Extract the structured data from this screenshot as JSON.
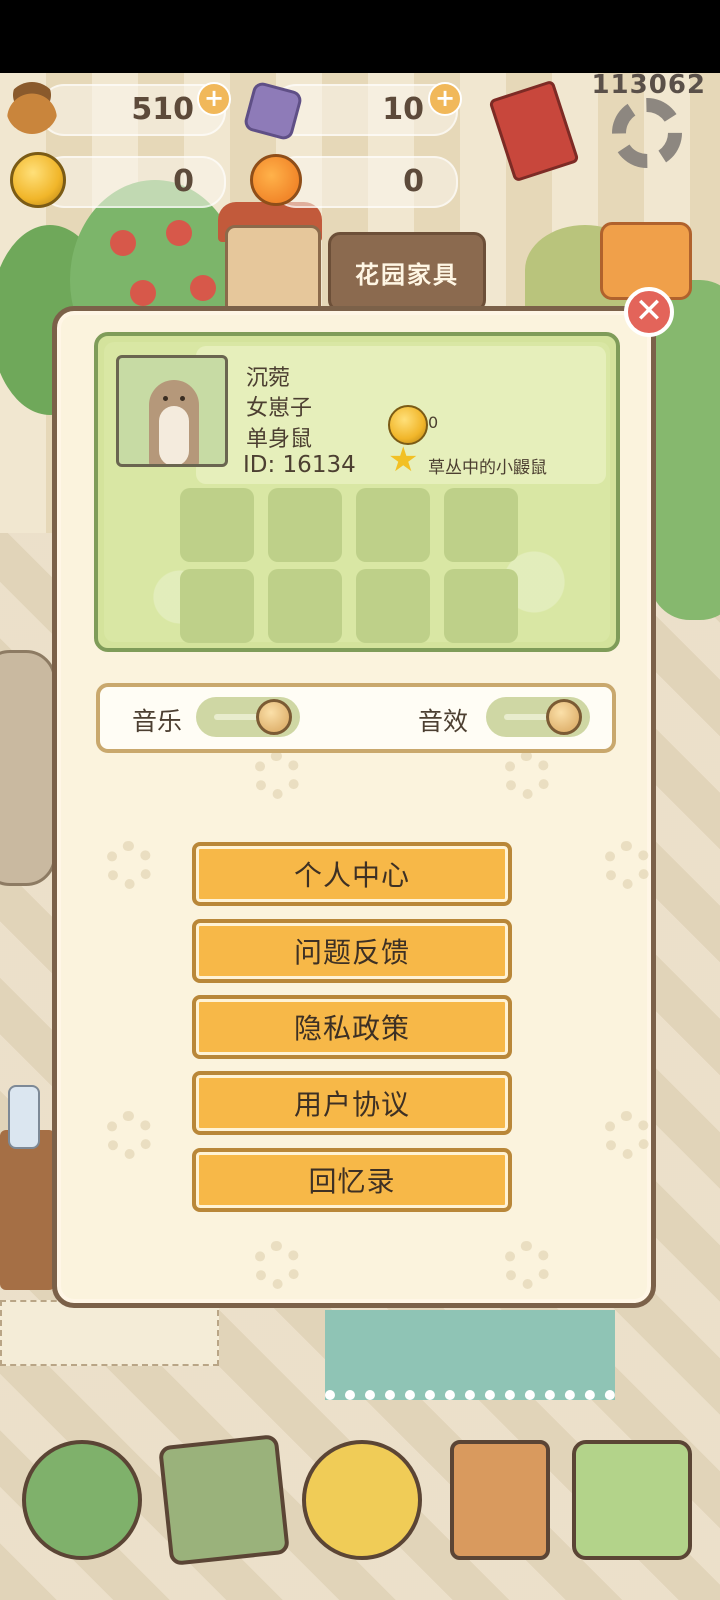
{
  "top_bar": {
    "acorns": "510",
    "crystals": "10",
    "bells": "0",
    "oranges": "0",
    "counter": "113062"
  },
  "background": {
    "shop_sign": "花园家具"
  },
  "profile": {
    "name": "沉菀",
    "title": "女崽子",
    "status": "单身鼠",
    "id": "ID: 16134",
    "bell_count": "0",
    "badge": "草丛中的小鼹鼠"
  },
  "settings": {
    "music_label": "音乐",
    "sfx_label": "音效",
    "music_on": true,
    "sfx_on": true
  },
  "menu": {
    "personal_center": "个人中心",
    "feedback": "问题反馈",
    "privacy": "隐私政策",
    "user_agreement": "用户协议",
    "memories": "回忆录"
  },
  "close_glyph": "✕",
  "plus_glyph": "+",
  "star_glyph": "★",
  "icons": [
    "acorn-icon",
    "crystal-icon",
    "bell-icon",
    "orange-icon",
    "book-icon",
    "gear-icon",
    "tv-icon",
    "house-icon",
    "mail-icon",
    "friends-icon",
    "tasks-icon",
    "map-icon"
  ]
}
